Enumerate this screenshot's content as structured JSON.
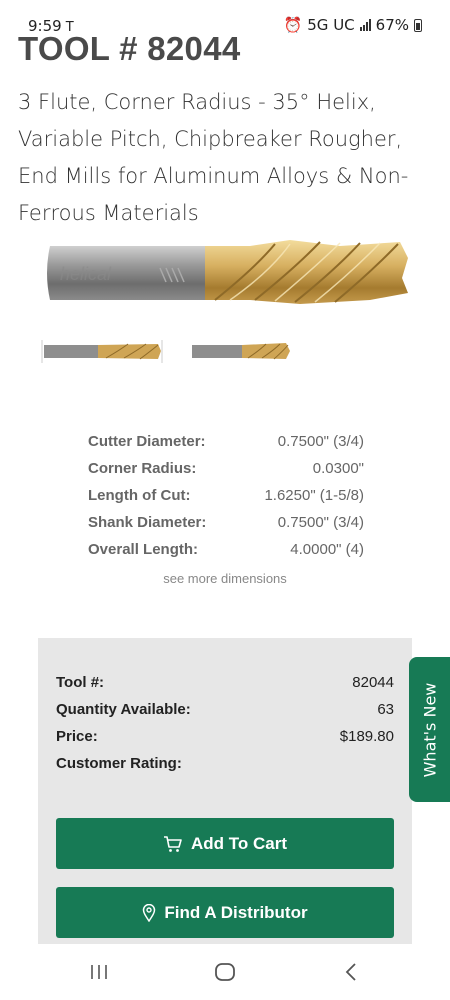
{
  "status_bar": {
    "time": "9:59",
    "network": "5G UC",
    "battery": "67%"
  },
  "product": {
    "title": "TOOL # 82044",
    "description": "3 Flute, Corner Radius - 35° Helix, Variable Pitch, Chipbreaker Rougher, End Mills for Aluminum Alloys & Non-Ferrous Materials"
  },
  "dimensions": [
    {
      "label": "Cutter Diameter:",
      "value": "0.7500\" (3/4)"
    },
    {
      "label": "Corner Radius:",
      "value": "0.0300\""
    },
    {
      "label": "Length of Cut:",
      "value": "1.6250\" (1-5/8)"
    },
    {
      "label": "Shank Diameter:",
      "value": "0.7500\" (3/4)"
    },
    {
      "label": "Overall Length:",
      "value": "4.0000\" (4)"
    }
  ],
  "see_more_label": "see more dimensions",
  "purchase": {
    "tool_label": "Tool #:",
    "tool_value": "82044",
    "qty_label": "Quantity Available:",
    "qty_value": "63",
    "price_label": "Price:",
    "price_value": "$189.80",
    "rating_label": "Customer Rating:",
    "add_to_cart": "Add To Cart",
    "find_distributor": "Find A Distributor"
  },
  "side_tab": "What's New",
  "colors": {
    "accent_green": "#177a55",
    "panel_gray": "#e7e7e7",
    "title_gray": "#4a4a4a"
  }
}
